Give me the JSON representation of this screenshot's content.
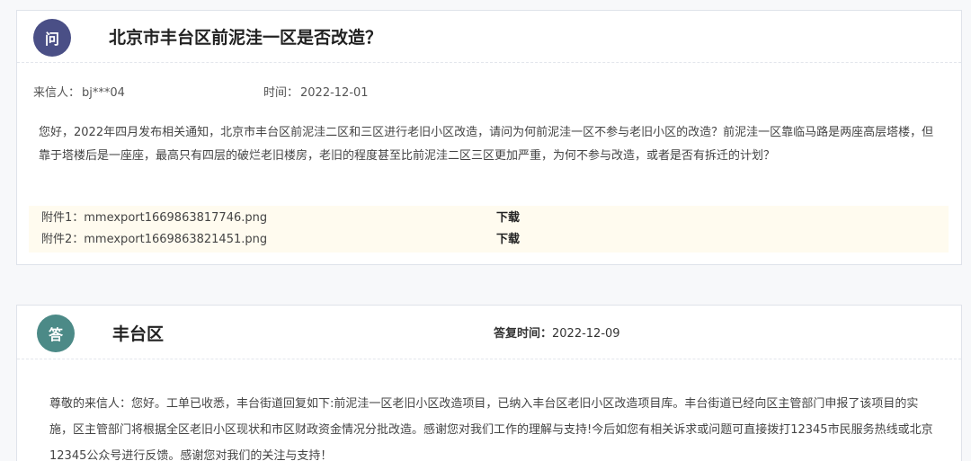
{
  "question": {
    "badge": "问",
    "title": "北京市丰台区前泥洼一区是否改造？",
    "sender_label": "来信人：",
    "sender": "bj***04",
    "time_label": "时间：",
    "time": "2022-12-01",
    "content": "您好，2022年四月发布相关通知，北京市丰台区前泥洼二区和三区进行老旧小区改造，请问为何前泥洼一区不参与老旧小区的改造？前泥洼一区靠临马路是两座高层塔楼，但靠于塔楼后是一座座，最高只有四层的破烂老旧楼房，老旧的程度甚至比前泥洼二区三区更加严重，为何不参与改造，或者是否有拆迁的计划？",
    "attachments": [
      {
        "name": "附件1：mmexport1669863817746.png",
        "action": "下载"
      },
      {
        "name": "附件2：mmexport1669863821451.png",
        "action": "下载"
      }
    ]
  },
  "answer": {
    "badge": "答",
    "department": "丰台区",
    "reply_time_label": "答复时间：",
    "reply_time": "2022-12-09",
    "content": "尊敬的来信人：您好。工单已收悉，丰台街道回复如下:前泥洼一区老旧小区改造项目，已纳入丰台区老旧小区改造项目库。丰台街道已经向区主管部门申报了该项目的实施，区主管部门将根据全区老旧小区现状和市区财政资金情况分批改造。感谢您对我们工作的理解与支持!今后如您有相关诉求或问题可直接拨打12345市民服务热线或北京12345公众号进行反馈。感谢您对我们的关注与支持！"
  },
  "colors": {
    "question_badge": "#4a4f86",
    "answer_badge": "#4c8a87",
    "attachment_bg": "#fffbef"
  }
}
